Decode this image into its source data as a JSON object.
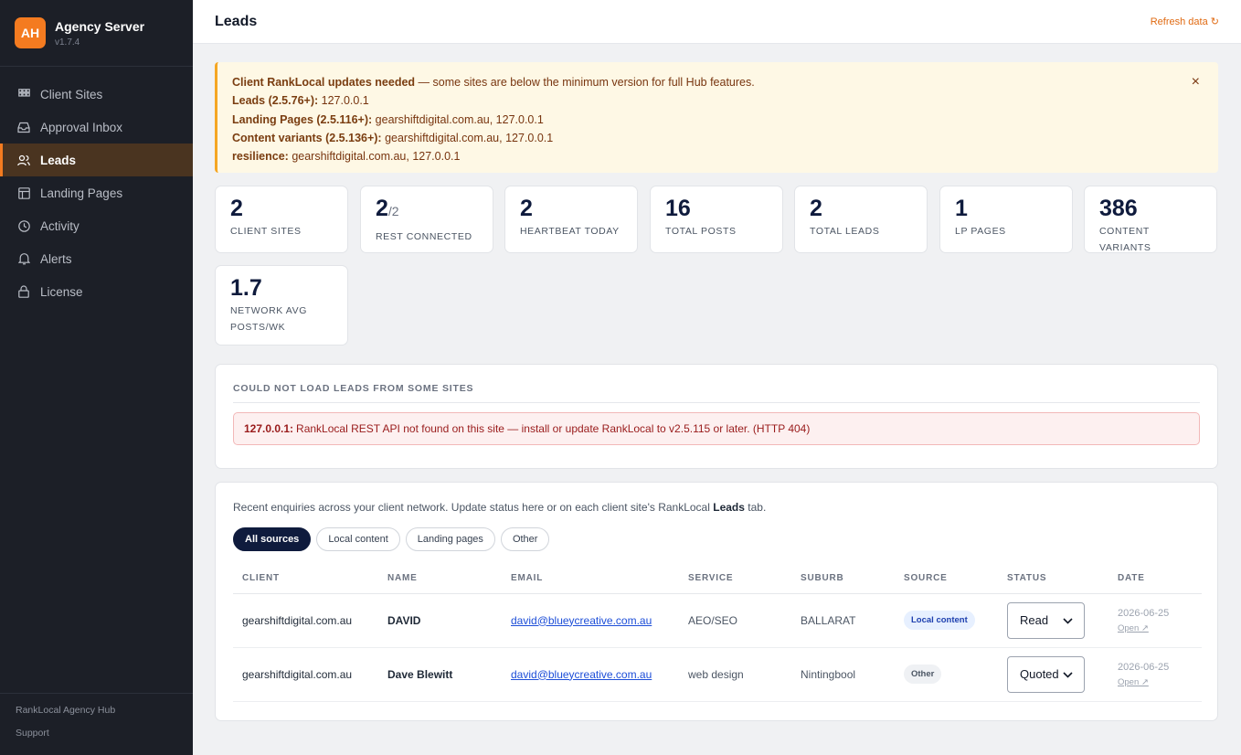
{
  "brand": {
    "logo": "AH",
    "name": "Agency Server",
    "version": "v1.7.4"
  },
  "nav": [
    {
      "label": "Client Sites",
      "icon": "grid-icon"
    },
    {
      "label": "Approval Inbox",
      "icon": "inbox-icon"
    },
    {
      "label": "Leads",
      "icon": "users-icon",
      "active": true
    },
    {
      "label": "Landing Pages",
      "icon": "layout-icon"
    },
    {
      "label": "Activity",
      "icon": "clock-icon"
    },
    {
      "label": "Alerts",
      "icon": "bell-icon"
    },
    {
      "label": "License",
      "icon": "lock-icon"
    }
  ],
  "sidebar_footer": {
    "product": "RankLocal Agency Hub",
    "support": "Support"
  },
  "header": {
    "title": "Leads",
    "refresh_label": "Refresh data ↻"
  },
  "alert": {
    "title": "Client RankLocal updates needed",
    "message": " — some sites are below the minimum version for full Hub features.",
    "lines": [
      {
        "label": "Leads (2.5.76+):",
        "value": " 127.0.0.1"
      },
      {
        "label": "Landing Pages (2.5.116+):",
        "value": " gearshiftdigital.com.au, 127.0.0.1"
      },
      {
        "label": "Content variants (2.5.136+):",
        "value": " gearshiftdigital.com.au, 127.0.0.1"
      },
      {
        "label": "resilience:",
        "value": " gearshiftdigital.com.au, 127.0.0.1"
      }
    ],
    "close": "×"
  },
  "stats": [
    {
      "value": "2",
      "suffix": "",
      "label": "Client Sites"
    },
    {
      "value": "2",
      "suffix": "/2",
      "label": "REST connected"
    },
    {
      "value": "2",
      "suffix": "",
      "label": "Heartbeat today"
    },
    {
      "value": "16",
      "suffix": "",
      "label": "Total posts"
    },
    {
      "value": "2",
      "suffix": "",
      "label": "Total leads"
    },
    {
      "value": "1",
      "suffix": "",
      "label": "LP pages"
    },
    {
      "value": "386",
      "suffix": "",
      "label": "Content variants"
    },
    {
      "value": "1.7",
      "suffix": "",
      "label": "Network avg posts/wk"
    }
  ],
  "errors": {
    "title": "COULD NOT LOAD LEADS FROM SOME SITES",
    "items": [
      {
        "site": "127.0.0.1:",
        "message": "RankLocal REST API not found on this site — install or update RankLocal to v2.5.115 or later. (HTTP 404)"
      }
    ]
  },
  "leads": {
    "intro_before": "Recent enquiries across your client network. Update status here or on each client site's RankLocal ",
    "intro_bold": "Leads",
    "intro_after": " tab.",
    "filters": [
      "All sources",
      "Local content",
      "Landing pages",
      "Other"
    ],
    "columns": [
      "CLIENT",
      "NAME",
      "EMAIL",
      "SERVICE",
      "SUBURB",
      "SOURCE",
      "STATUS",
      "DATE"
    ],
    "rows": [
      {
        "client": "gearshiftdigital.com.au",
        "name": "DAVID",
        "email": "david@blueycreative.com.au",
        "service": "AEO/SEO",
        "suburb": "BALLARAT",
        "source": "Local content",
        "source_kind": "local",
        "status": "Read",
        "date": "2026-06-25",
        "open": "Open ↗"
      },
      {
        "client": "gearshiftdigital.com.au",
        "name": "Dave Blewitt",
        "email": "david@blueycreative.com.au",
        "service": "web design",
        "suburb": "Nintingbool",
        "source": "Other",
        "source_kind": "other",
        "status": "Quoted",
        "date": "2026-06-25",
        "open": "Open ↗"
      }
    ]
  }
}
